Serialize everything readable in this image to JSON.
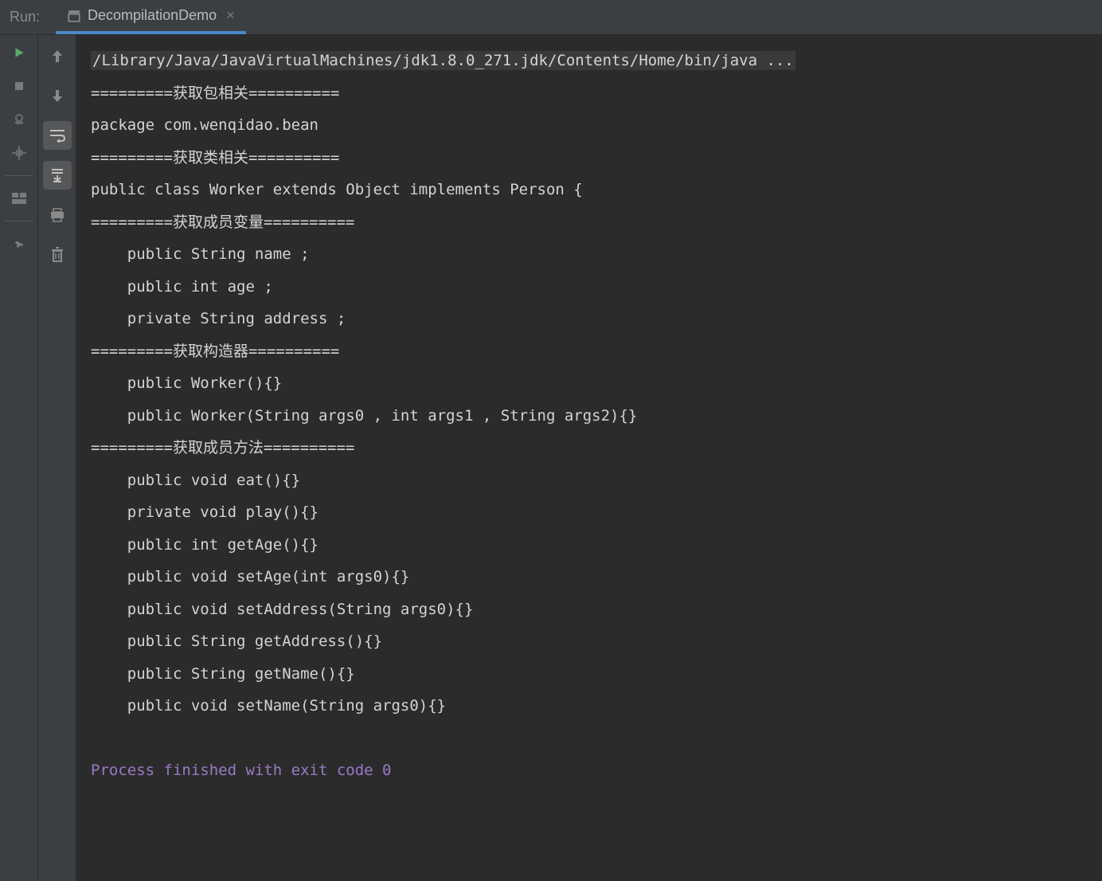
{
  "header": {
    "run_label": "Run:",
    "tab_title": "DecompilationDemo"
  },
  "console": {
    "cmd": "/Library/Java/JavaVirtualMachines/jdk1.8.0_271.jdk/Contents/Home/bin/java ...",
    "lines": [
      "=========获取包相关==========",
      "package com.wenqidao.bean",
      "=========获取类相关==========",
      "public class Worker extends Object implements Person {",
      "=========获取成员变量==========",
      "    public String name ;",
      "    public int age ;",
      "    private String address ;",
      "=========获取构造器==========",
      "    public Worker(){}",
      "    public Worker(String args0 , int args1 , String args2){}",
      "=========获取成员方法==========",
      "    public void eat(){}",
      "    private void play(){}",
      "    public int getAge(){}",
      "    public void setAge(int args0){}",
      "    public void setAddress(String args0){}",
      "    public String getAddress(){}",
      "    public String getName(){}",
      "    public void setName(String args0){}",
      ""
    ],
    "exit_line": "Process finished with exit code 0"
  }
}
